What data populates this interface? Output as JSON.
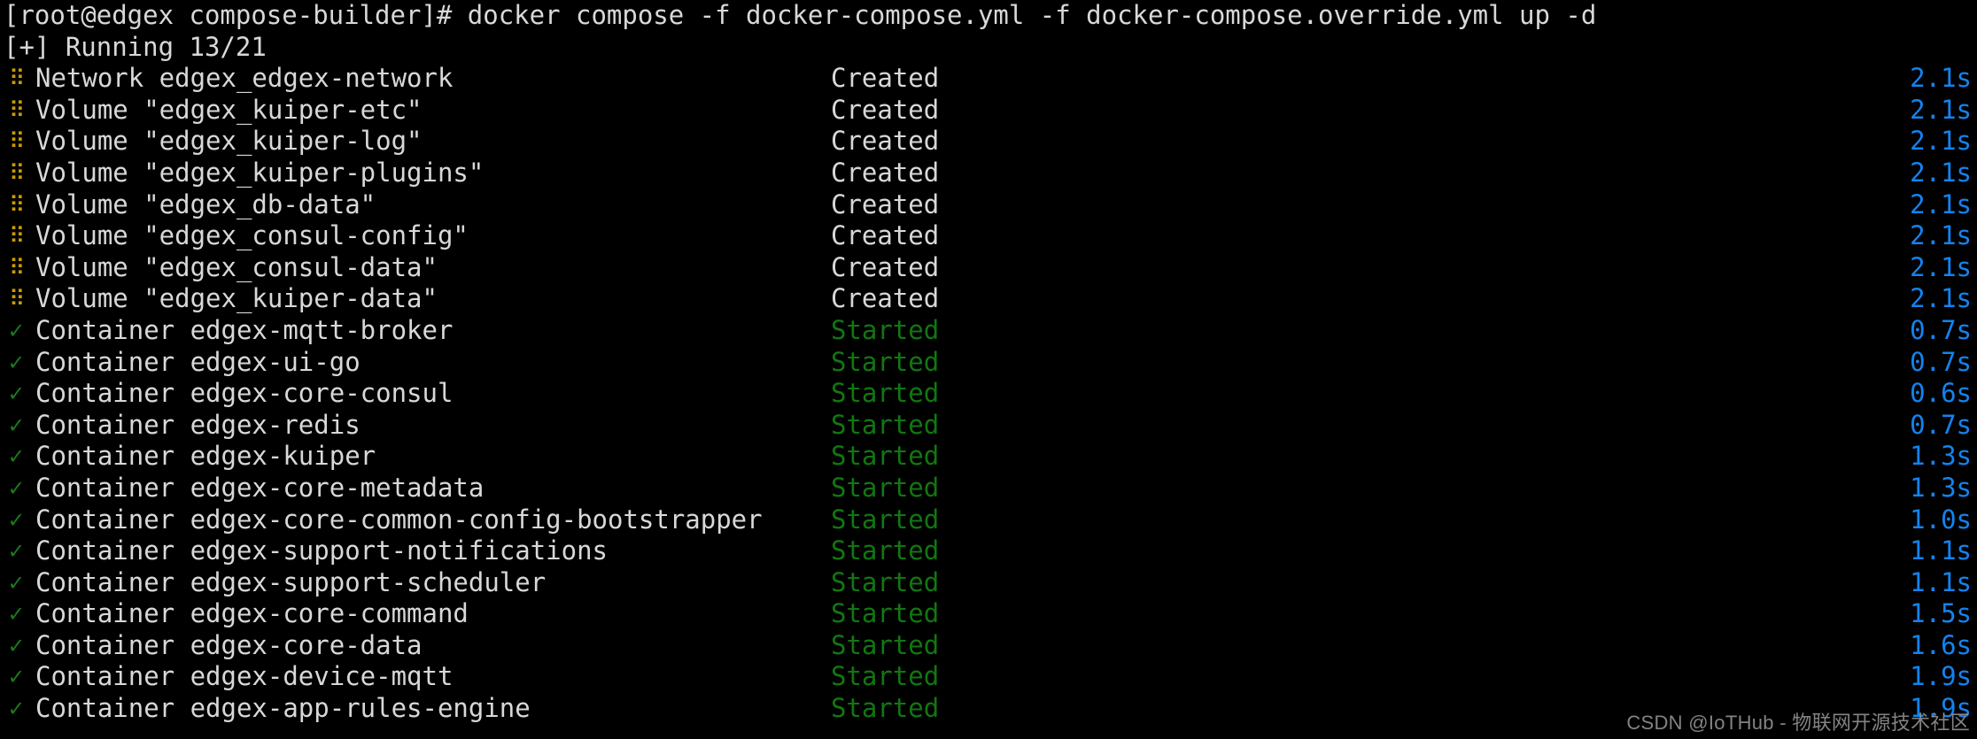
{
  "terminal": {
    "background_color": "#000000",
    "foreground_color": "#d8d8d8",
    "accent_time_color": "#1383f0",
    "started_color": "#117711",
    "pending_glyph_color": "#cc9a00",
    "check_glyph_color": "#1a7a1a",
    "prompt": "[root@edgex compose-builder]#",
    "command": "docker compose -f docker-compose.yml -f docker-compose.override.yml up -d",
    "prompt_line": "[root@edgex compose-builder]# docker compose -f docker-compose.yml -f docker-compose.override.yml up -d",
    "progress_line": "[+] Running 13/21",
    "progress": {
      "marker": "[+]",
      "label": "Running",
      "completed": 13,
      "total": 21,
      "fraction": "13/21"
    },
    "glyphs": {
      "pending": "⠿",
      "done": "✓"
    },
    "rows": [
      {
        "glyph": "pending",
        "kind": "Network",
        "name": "edgex_edgex-network",
        "label": "Network edgex_edgex-network",
        "status": "Created",
        "time": "2.1s"
      },
      {
        "glyph": "pending",
        "kind": "Volume",
        "name": "\"edgex_kuiper-etc\"",
        "label": "Volume \"edgex_kuiper-etc\"",
        "status": "Created",
        "time": "2.1s"
      },
      {
        "glyph": "pending",
        "kind": "Volume",
        "name": "\"edgex_kuiper-log\"",
        "label": "Volume \"edgex_kuiper-log\"",
        "status": "Created",
        "time": "2.1s"
      },
      {
        "glyph": "pending",
        "kind": "Volume",
        "name": "\"edgex_kuiper-plugins\"",
        "label": "Volume \"edgex_kuiper-plugins\"",
        "status": "Created",
        "time": "2.1s"
      },
      {
        "glyph": "pending",
        "kind": "Volume",
        "name": "\"edgex_db-data\"",
        "label": "Volume \"edgex_db-data\"",
        "status": "Created",
        "time": "2.1s"
      },
      {
        "glyph": "pending",
        "kind": "Volume",
        "name": "\"edgex_consul-config\"",
        "label": "Volume \"edgex_consul-config\"",
        "status": "Created",
        "time": "2.1s"
      },
      {
        "glyph": "pending",
        "kind": "Volume",
        "name": "\"edgex_consul-data\"",
        "label": "Volume \"edgex_consul-data\"",
        "status": "Created",
        "time": "2.1s"
      },
      {
        "glyph": "pending",
        "kind": "Volume",
        "name": "\"edgex_kuiper-data\"",
        "label": "Volume \"edgex_kuiper-data\"",
        "status": "Created",
        "time": "2.1s"
      },
      {
        "glyph": "done",
        "kind": "Container",
        "name": "edgex-mqtt-broker",
        "label": "Container edgex-mqtt-broker",
        "status": "Started",
        "time": "0.7s"
      },
      {
        "glyph": "done",
        "kind": "Container",
        "name": "edgex-ui-go",
        "label": "Container edgex-ui-go",
        "status": "Started",
        "time": "0.7s"
      },
      {
        "glyph": "done",
        "kind": "Container",
        "name": "edgex-core-consul",
        "label": "Container edgex-core-consul",
        "status": "Started",
        "time": "0.6s"
      },
      {
        "glyph": "done",
        "kind": "Container",
        "name": "edgex-redis",
        "label": "Container edgex-redis",
        "status": "Started",
        "time": "0.7s"
      },
      {
        "glyph": "done",
        "kind": "Container",
        "name": "edgex-kuiper",
        "label": "Container edgex-kuiper",
        "status": "Started",
        "time": "1.3s"
      },
      {
        "glyph": "done",
        "kind": "Container",
        "name": "edgex-core-metadata",
        "label": "Container edgex-core-metadata",
        "status": "Started",
        "time": "1.3s"
      },
      {
        "glyph": "done",
        "kind": "Container",
        "name": "edgex-core-common-config-bootstrapper",
        "label": "Container edgex-core-common-config-bootstrapper",
        "status": "Started",
        "time": "1.0s"
      },
      {
        "glyph": "done",
        "kind": "Container",
        "name": "edgex-support-notifications",
        "label": "Container edgex-support-notifications",
        "status": "Started",
        "time": "1.1s"
      },
      {
        "glyph": "done",
        "kind": "Container",
        "name": "edgex-support-scheduler",
        "label": "Container edgex-support-scheduler",
        "status": "Started",
        "time": "1.1s"
      },
      {
        "glyph": "done",
        "kind": "Container",
        "name": "edgex-core-command",
        "label": "Container edgex-core-command",
        "status": "Started",
        "time": "1.5s"
      },
      {
        "glyph": "done",
        "kind": "Container",
        "name": "edgex-core-data",
        "label": "Container edgex-core-data",
        "status": "Started",
        "time": "1.6s"
      },
      {
        "glyph": "done",
        "kind": "Container",
        "name": "edgex-device-mqtt",
        "label": "Container edgex-device-mqtt",
        "status": "Started",
        "time": "1.9s"
      },
      {
        "glyph": "done",
        "kind": "Container",
        "name": "edgex-app-rules-engine",
        "label": "Container edgex-app-rules-engine",
        "status": "Started",
        "time": "1.9s"
      }
    ]
  },
  "watermark": {
    "text": "CSDN @IoTHub - 物联网开源技术社区"
  }
}
